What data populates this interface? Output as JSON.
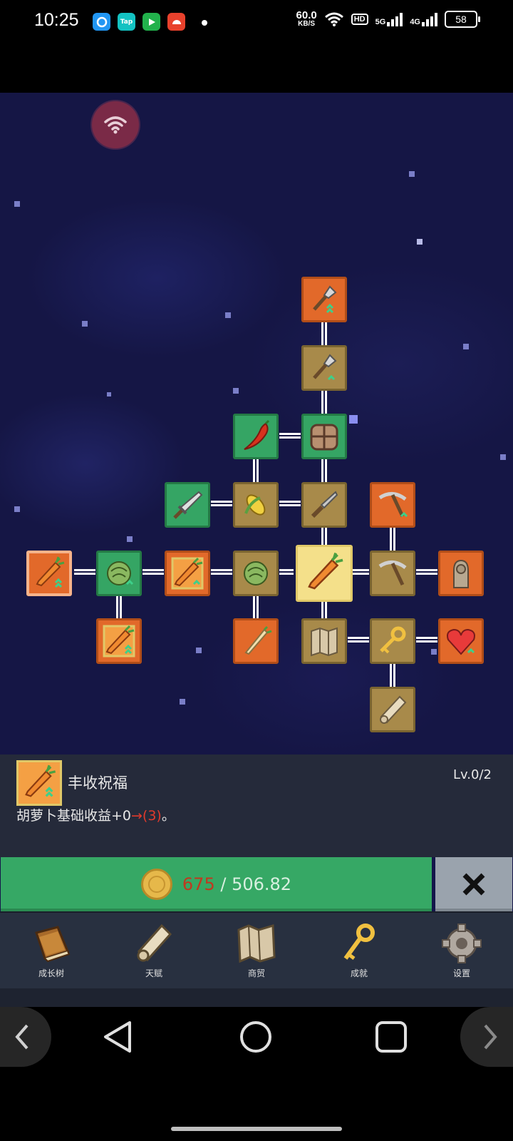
{
  "status_bar": {
    "time": "10:25",
    "apps": [
      {
        "icon": "app-blue-icon",
        "color": "#2196f3",
        "label": ""
      },
      {
        "icon": "taptap-icon",
        "color": "#13c2c2",
        "label": "Tap"
      },
      {
        "icon": "iqiyi-icon",
        "color": "#22b14c",
        "label": ""
      },
      {
        "icon": "app-red-icon",
        "color": "#e8412c",
        "label": ""
      }
    ],
    "net_speed_value": "60.0",
    "net_speed_unit": "KB/S",
    "hd_label": "HD",
    "sim1_label": "5G",
    "sim2_label": "4G",
    "battery": "58"
  },
  "skill_tree": {
    "selected_skill": {
      "name": "丰收祝福",
      "level": "Lv.0/2",
      "desc_prefix": "胡萝卜基础收益+0",
      "desc_arrow": "→(3)",
      "desc_suffix": "。"
    },
    "colors": {
      "orange": "#e2692a",
      "brown": "#a88a4a",
      "green": "#35a564",
      "selected": "#f4e08a"
    }
  },
  "buy_button": {
    "cost": "675",
    "separator": "/",
    "balance": "506.82"
  },
  "nav": {
    "items": [
      {
        "label": "成长树",
        "icon": "book-icon"
      },
      {
        "label": "天赋",
        "icon": "scroll-icon"
      },
      {
        "label": "商贸",
        "icon": "map-icon"
      },
      {
        "label": "成就",
        "icon": "key-icon"
      },
      {
        "label": "设置",
        "icon": "gear-icon"
      }
    ]
  }
}
